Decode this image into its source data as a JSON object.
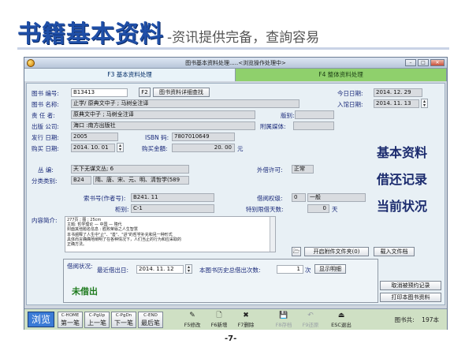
{
  "slide": {
    "title": "书籍基本资料",
    "subtitle": "-资讯提供完备，查詢容易",
    "page_number": "-7-"
  },
  "window": {
    "title": "图书基本资料处理.....<浏览操作处理中>",
    "min": "–",
    "max": "□",
    "close": "✕"
  },
  "tabs": [
    {
      "label": "F3 基本资料处理"
    },
    {
      "label": "F4 整体资料处理"
    }
  ],
  "form": {
    "book_no_label": "图书 编号:",
    "book_no": "B13413",
    "f2_label": "F2",
    "detail_btn": "图书资料详细查找",
    "today_label": "今日日期:",
    "today": "2014. 12. 29",
    "name_label": "图书 名称:",
    "name": "止学/ 原典文中子 ; 马树全注译",
    "arrive_label": "入馆日期:",
    "arrive": "2014. 11. 13",
    "author_label": "责 任 者:",
    "author": "原典文中子 ; 马树全注译",
    "edition_label": "版别:",
    "edition": "",
    "publisher_label": "出版 公司:",
    "publisher": "海口 :南方出版社",
    "media_label": "附属媒体:",
    "media": "",
    "pubdate_label": "发行 日期:",
    "pubdate": "2005",
    "isbn_label": "ISBN 码:",
    "isbn": "7807010649",
    "buydate_label": "购买 日期:",
    "buydate": "2014. 10. 01",
    "price_label": "购买金額:",
    "price": "20. 00",
    "price_unit": "元",
    "series_label": "丛  编:",
    "series": "天下无谋文丛; 6",
    "lend_ok_label": "外借许可:",
    "lend_ok": "正常",
    "category_label": "分类类别:",
    "category_code": "B24",
    "category_name": "隋、唐、宋、元、明、清哲学(589",
    "callno_label": "索书号(作者号):",
    "callno": "B241. 11",
    "cabinet_label": "柜别:",
    "cabinet": "C-1",
    "level_label": "借阅权级:",
    "level_code": "0",
    "level_name": "一般",
    "special_days_label": "特别限借天数:",
    "special_days": "0",
    "days_unit": "天",
    "intro_label": "内容简介:",
    "intro_lines": [
      "277页 ; 图 ; 25cm",
      "主题: 哲学理论 — 中国 — 隋代",
      "封面其他题名信息 : 胜败荣辱之人生智慧",
      "本书阐释了人生中\"止\"、\"善\"、\"进\"的哲学补充和另一种形式",
      "具体而言确确地阐明了在各种情况下，人们当止的行为和应采取的",
      "正确方法。"
    ],
    "attach_btn": "开启附件文件夹(0)",
    "load_doc_btn": "载入文件档"
  },
  "borrow": {
    "status_label": "借阅状况:",
    "last_date_label": "最近借出日:",
    "last_date": "2014. 11. 12",
    "history_label": "本图书历史总借出次数:",
    "history_count": "1",
    "history_unit": "次",
    "detail_btn": "显示明细",
    "status": "未借出",
    "cancel_reserve_btn": "取消被预约记录",
    "print_btn": "打印本图书资料"
  },
  "side_labels": {
    "basic": "基本资料",
    "borrow": "借还记录",
    "current": "当前状况"
  },
  "toolbar": {
    "browse": "浏览",
    "first_key": "C-HOME",
    "first": "第一笔",
    "prev_key": "C-PgUp",
    "prev": "上一笔",
    "next_key": "C-PgDn",
    "next": "下一笔",
    "last_key": "C-END",
    "last": "最后笔",
    "f5": "F5修改",
    "f6": "F6新增",
    "f7": "F7删除",
    "f8": "F8存档",
    "f9": "F9还原",
    "esc": "ESC退出",
    "count_label": "图书共:",
    "count": "197本"
  }
}
